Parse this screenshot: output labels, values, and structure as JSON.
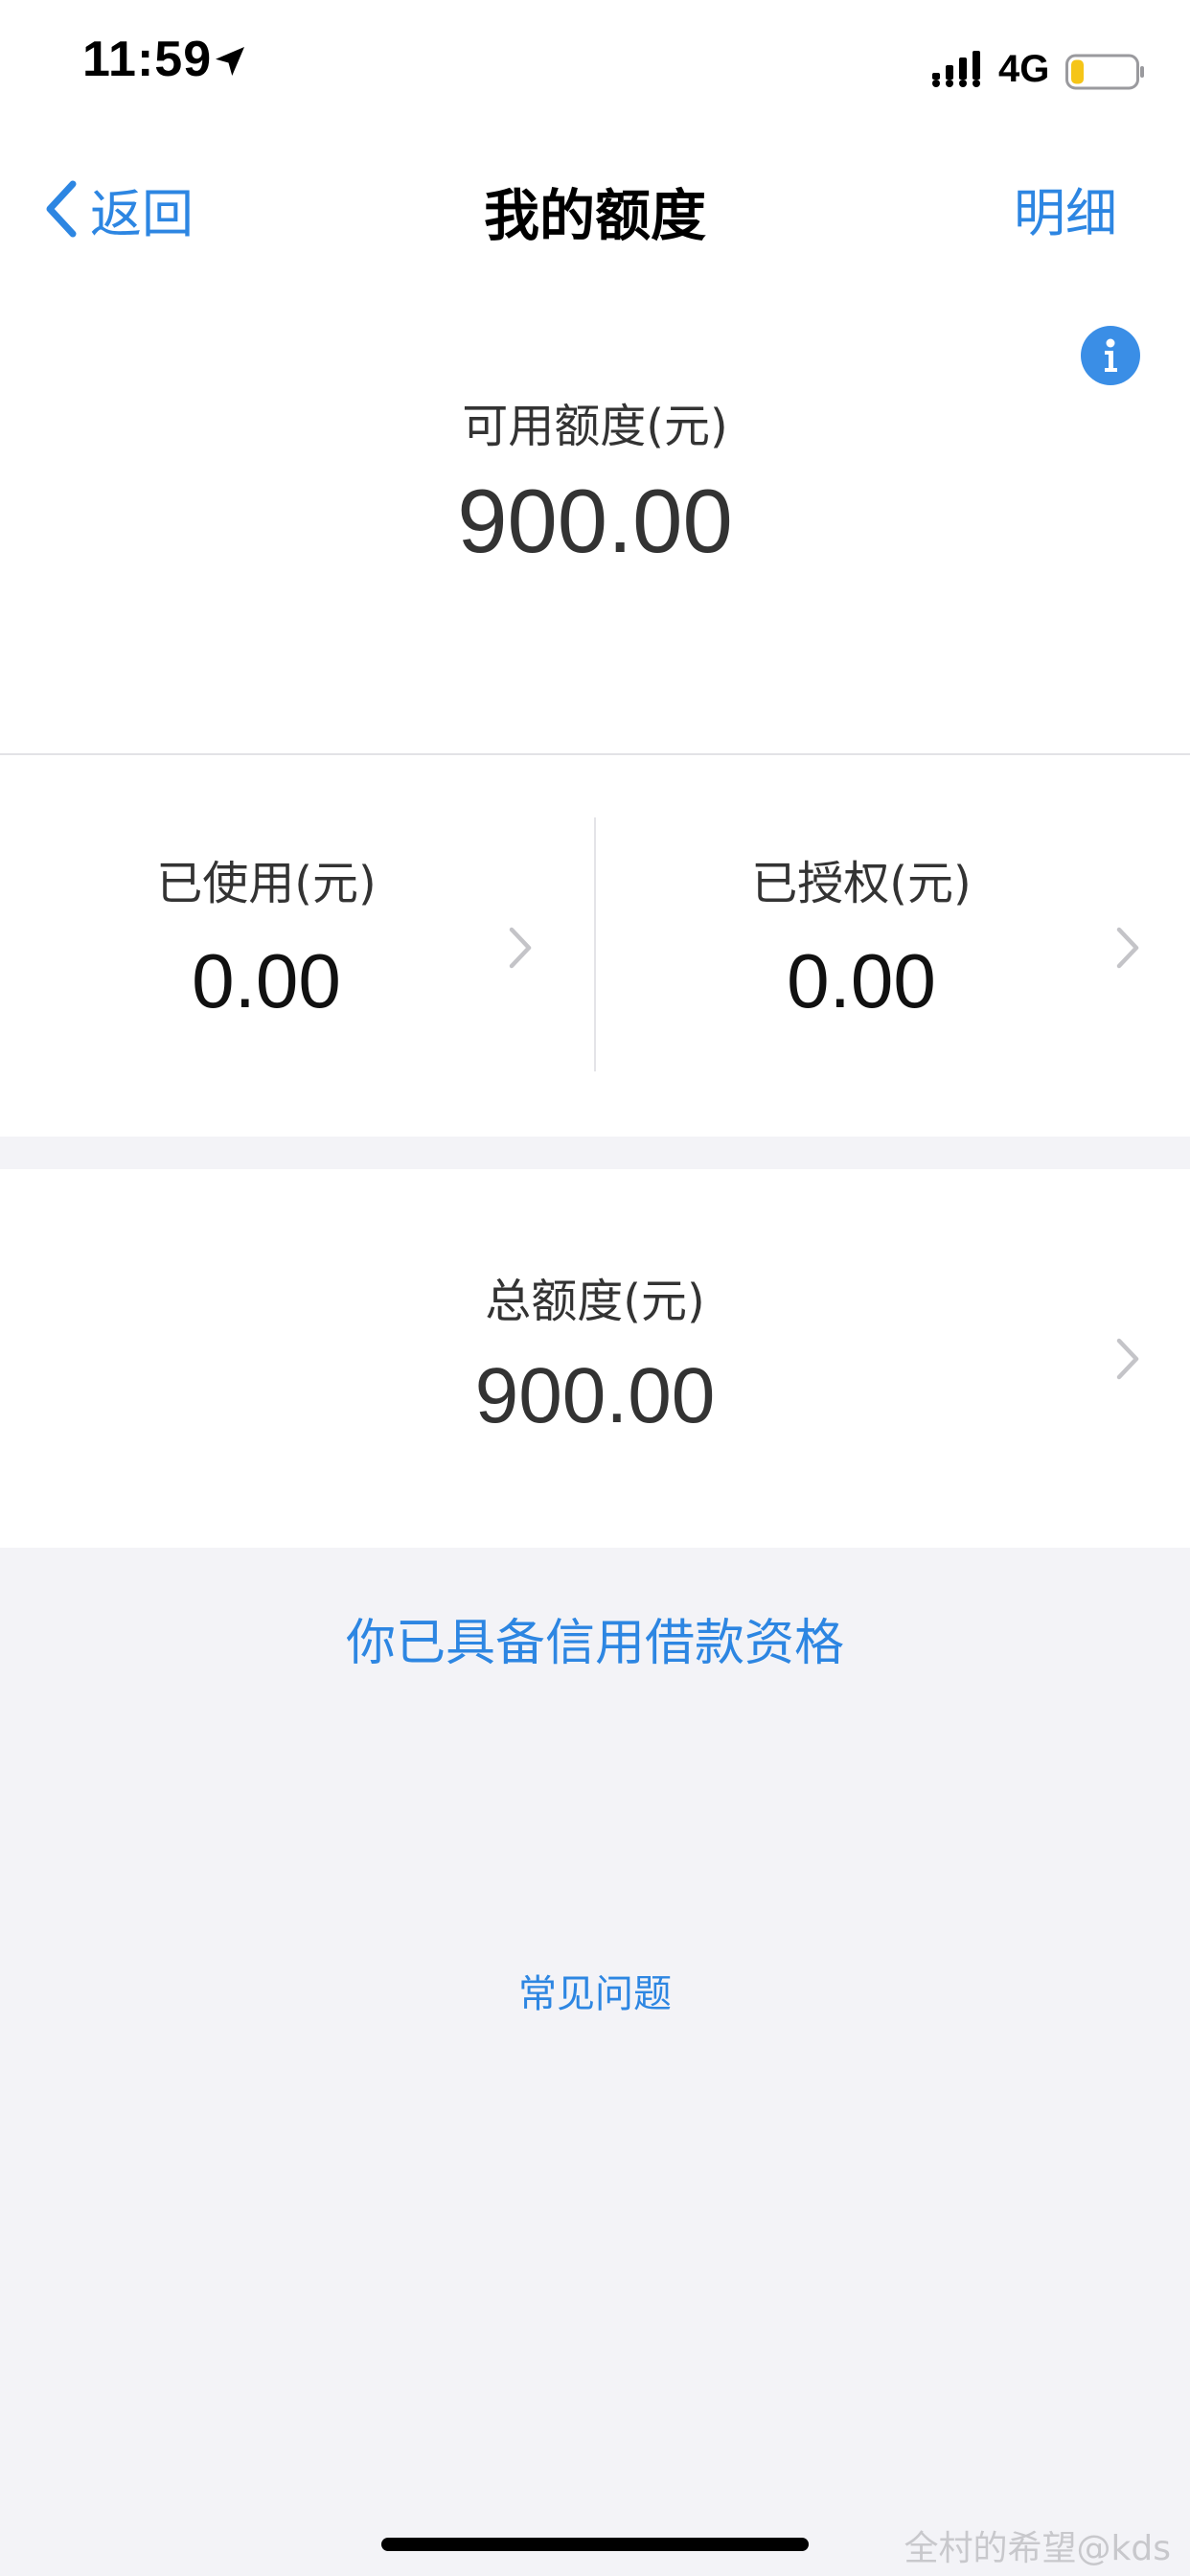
{
  "status_bar": {
    "time": "11:59",
    "network": "4G",
    "battery_fill_fraction": 0.2,
    "battery_color": "#f5c518"
  },
  "nav": {
    "back_label": "返回",
    "title": "我的额度",
    "detail_label": "明细"
  },
  "available": {
    "label": "可用额度(元)",
    "value": "900.00"
  },
  "used": {
    "label": "已使用(元)",
    "value": "0.00"
  },
  "authorized": {
    "label": "已授权(元)",
    "value": "0.00"
  },
  "total": {
    "label": "总额度(元)",
    "value": "900.00"
  },
  "eligibility_text": "你已具备信用借款资格",
  "faq_label": "常见问题",
  "watermark": "全村的希望@kds",
  "colors": {
    "accent": "#2d86e2",
    "background": "#f3f3f7",
    "panel": "#ffffff"
  },
  "icons": {
    "back": "chevron-left-icon",
    "info": "info-icon",
    "row_arrow": "chevron-right-icon",
    "location": "location-arrow-icon",
    "signal": "cellular-signal-icon",
    "battery": "battery-icon"
  }
}
